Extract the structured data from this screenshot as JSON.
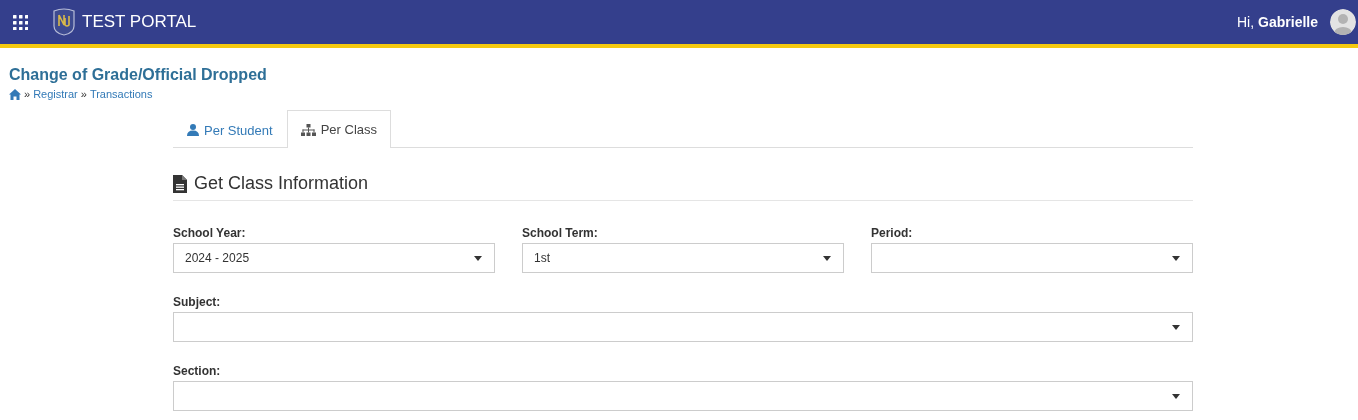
{
  "header": {
    "title": "TEST PORTAL",
    "greeting": "Hi,",
    "user": "Gabrielle"
  },
  "page_title": "Change of Grade/Official Dropped",
  "breadcrumb": [
    "Registrar",
    "Transactions"
  ],
  "breadcrumb_separator": "»",
  "tabs": [
    {
      "label": "Per Student",
      "kind": "student",
      "selected": false
    },
    {
      "label": "Per Class",
      "kind": "class",
      "selected": true
    }
  ],
  "section_title": "Get Class Information",
  "form_rows": [
    [
      {
        "label": "School Year:",
        "value": "2024 - 2025"
      },
      {
        "label": "School Term:",
        "value": "1st"
      },
      {
        "label": "Period:"
      }
    ],
    [
      {
        "label": "Subject:"
      }
    ],
    [
      {
        "label": "Section:"
      }
    ]
  ]
}
